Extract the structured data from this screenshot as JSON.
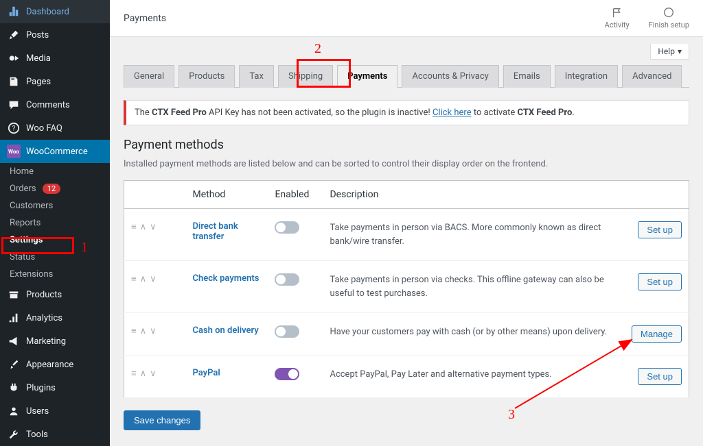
{
  "sidebar": {
    "items": [
      {
        "label": "Dashboard",
        "icon": "dashboard"
      },
      {
        "label": "Posts",
        "icon": "pin"
      },
      {
        "label": "Media",
        "icon": "media"
      },
      {
        "label": "Pages",
        "icon": "page"
      },
      {
        "label": "Comments",
        "icon": "comment"
      },
      {
        "label": "Woo FAQ",
        "icon": "help"
      },
      {
        "label": "WooCommerce",
        "icon": "woo",
        "active": true
      },
      {
        "label": "Products",
        "icon": "archive"
      },
      {
        "label": "Analytics",
        "icon": "chart"
      },
      {
        "label": "Marketing",
        "icon": "megaphone"
      },
      {
        "label": "Appearance",
        "icon": "brush"
      },
      {
        "label": "Plugins",
        "icon": "plug"
      },
      {
        "label": "Users",
        "icon": "user"
      },
      {
        "label": "Tools",
        "icon": "wrench"
      }
    ],
    "woo_sub": [
      {
        "label": "Home"
      },
      {
        "label": "Orders",
        "badge": "12"
      },
      {
        "label": "Customers"
      },
      {
        "label": "Reports"
      },
      {
        "label": "Settings",
        "current": true
      },
      {
        "label": "Status"
      },
      {
        "label": "Extensions"
      }
    ]
  },
  "topbar": {
    "title": "Payments",
    "activity": "Activity",
    "finish": "Finish setup"
  },
  "help_label": "Help",
  "tabs": [
    "General",
    "Products",
    "Tax",
    "Shipping",
    "Payments",
    "Accounts & Privacy",
    "Emails",
    "Integration",
    "Advanced"
  ],
  "active_tab": "Payments",
  "notice": {
    "pre": "The ",
    "bold1": "CTX Feed Pro",
    "mid": " API Key has not been activated, so the plugin is inactive! ",
    "link": "Click here",
    "mid2": " to activate ",
    "bold2": "CTX Feed Pro",
    "end": "."
  },
  "section": {
    "title": "Payment methods",
    "desc": "Installed payment methods are listed below and can be sorted to control their display order on the frontend."
  },
  "headers": {
    "method": "Method",
    "enabled": "Enabled",
    "description": "Description"
  },
  "methods": [
    {
      "name": "Direct bank transfer",
      "enabled": false,
      "desc": "Take payments in person via BACS. More commonly known as direct bank/wire transfer.",
      "btn": "Set up"
    },
    {
      "name": "Check payments",
      "enabled": false,
      "desc": "Take payments in person via checks. This offline gateway can also be useful to test purchases.",
      "btn": "Set up"
    },
    {
      "name": "Cash on delivery",
      "enabled": false,
      "desc": "Have your customers pay with cash (or by other means) upon delivery.",
      "btn": "Manage"
    },
    {
      "name": "PayPal",
      "enabled": true,
      "desc": "Accept PayPal, Pay Later and alternative payment types.",
      "btn": "Set up"
    }
  ],
  "save": "Save changes",
  "annotations": {
    "a1": "1",
    "a2": "2",
    "a3": "3"
  }
}
